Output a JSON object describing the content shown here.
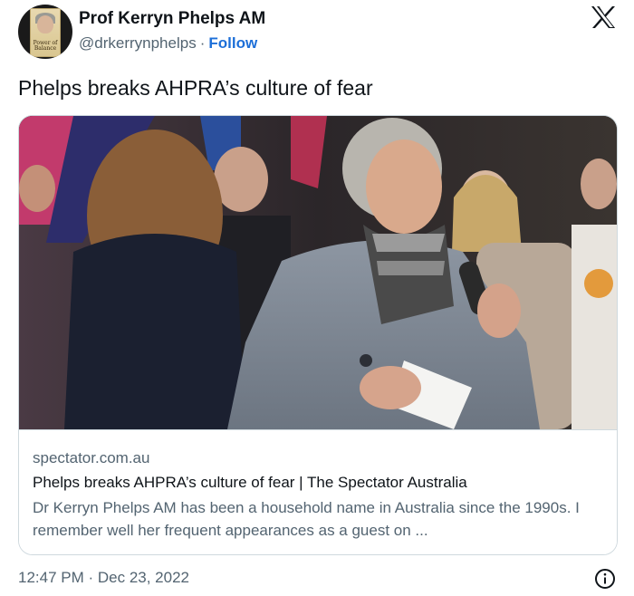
{
  "author": {
    "display_name": "Prof Kerryn Phelps AM",
    "handle": "@drkerrynphelps",
    "separator": "·",
    "follow_label": "Follow",
    "avatar_book_text": "Power of Balance"
  },
  "platform_icon": "x-logo-icon",
  "tweet": {
    "text": "Phelps breaks AHPRA’s culture of fear"
  },
  "card": {
    "domain": "spectator.com.au",
    "title": "Phelps breaks AHPRA’s culture of fear | The Spectator Australia",
    "description": "Dr Kerryn Phelps AM has been a household name in Australia since the 1990s. I remember well her frequent appearances as a guest on ...",
    "image_icon": "article-photo"
  },
  "footer": {
    "timestamp": "12:47 PM · Dec 23, 2022",
    "info_icon": "info-icon"
  },
  "colors": {
    "link": "#1d6fd8",
    "secondary_text": "#536471",
    "border": "#cfd9de"
  }
}
